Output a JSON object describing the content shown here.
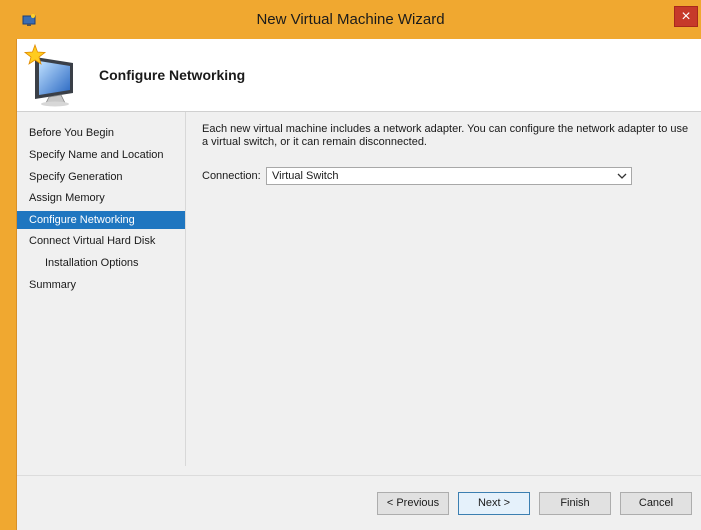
{
  "window": {
    "title": "New Virtual Machine Wizard",
    "close_symbol": "×"
  },
  "header": {
    "title": "Configure Networking",
    "icon": "monitor-star-icon"
  },
  "sidebar": {
    "items": [
      {
        "label": "Before You Begin",
        "active": false,
        "sub": false
      },
      {
        "label": "Specify Name and Location",
        "active": false,
        "sub": false
      },
      {
        "label": "Specify Generation",
        "active": false,
        "sub": false
      },
      {
        "label": "Assign Memory",
        "active": false,
        "sub": false
      },
      {
        "label": "Configure Networking",
        "active": true,
        "sub": false
      },
      {
        "label": "Connect Virtual Hard Disk",
        "active": false,
        "sub": false
      },
      {
        "label": "Installation Options",
        "active": false,
        "sub": true
      },
      {
        "label": "Summary",
        "active": false,
        "sub": false
      }
    ]
  },
  "content": {
    "description": "Each new virtual machine includes a network adapter. You can configure the network adapter to use a virtual switch, or it can remain disconnected.",
    "connection_label": "Connection:",
    "connection_value": "Virtual Switch"
  },
  "buttons": {
    "previous": "< Previous",
    "next": "Next >",
    "finish": "Finish",
    "cancel": "Cancel"
  },
  "colors": {
    "frame": "#f0a830",
    "selection": "#1f76c0",
    "close": "#c6392a"
  }
}
